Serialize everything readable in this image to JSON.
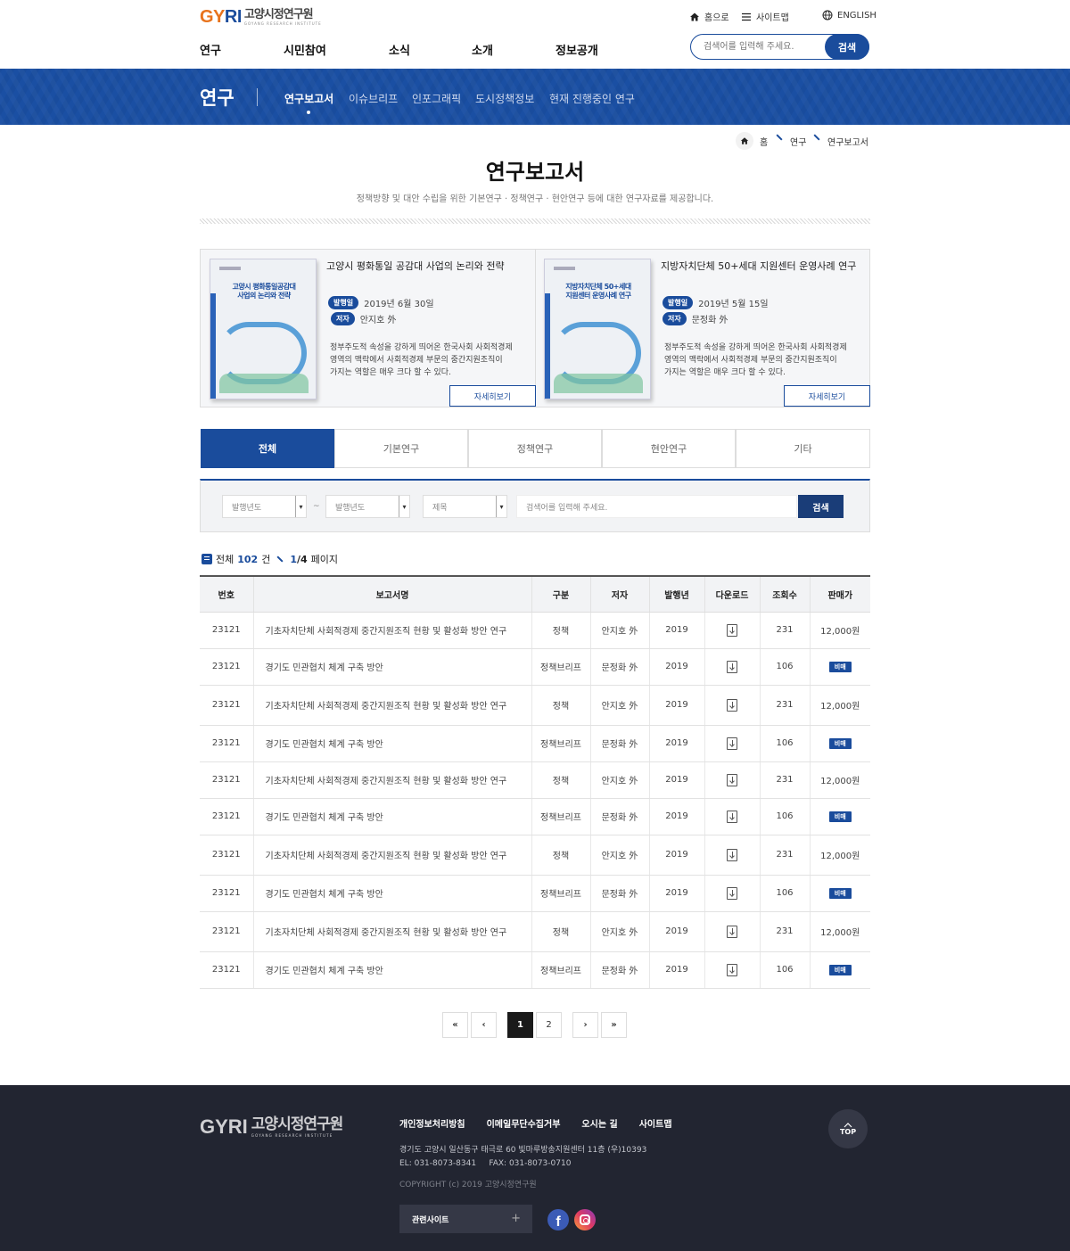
{
  "header": {
    "logo_mark_a": "GY",
    "logo_mark_b": "RI",
    "logo_ko": "고양시정연구원",
    "logo_en": "GOYANG RESEARCH INSTITUTE",
    "util": {
      "home": "홈으로",
      "sitemap": "사이트맵",
      "english": "ENGLISH"
    },
    "gnb": [
      "연구",
      "시민참여",
      "소식",
      "소개",
      "정보공개"
    ],
    "search": {
      "placeholder": "검색어를 입력해 주세요.",
      "button": "검색"
    }
  },
  "section_bar": {
    "title": "연구",
    "subnav": [
      "연구보고서",
      "이슈브리프",
      "인포그래픽",
      "도시정책정보",
      "현재 진행중인 연구"
    ],
    "active_index": 0
  },
  "breadcrumb": [
    "홈",
    "연구",
    "연구보고서"
  ],
  "page": {
    "title": "연구보고서",
    "description": "정책방향 및 대안 수립을 위한 기본연구 · 정책연구 · 현안연구 등에 대한 연구자료를 제공합니다."
  },
  "featured": [
    {
      "cover_title_1": "고양시 평화통일공감대",
      "cover_title_2": "사업의 논리와 전략",
      "title": "고양시 평화통일 공감대 사업의 논리와 전략",
      "date_label": "발행일",
      "date": "2019년 6월 30일",
      "author_label": "저자",
      "author": "안지호 外",
      "desc_1": "정부주도적 속성을 강하게 띄어온 한국사회 사회적경제",
      "desc_2": "영역의 맥락에서 사회적경제 부문의 중간지원조직이",
      "desc_3": "가지는 역할은 매우 크다 할 수 있다.",
      "more": "자세히보기"
    },
    {
      "cover_title_1": "지방자치단체 50+세대",
      "cover_title_2": "지원센터 운영사례 연구",
      "title": "지방자치단체 50+세대 지원센터 운영사례 연구",
      "date_label": "발행일",
      "date": "2019년 5월 15일",
      "author_label": "저자",
      "author": "문정화 外",
      "desc_1": "정부주도적 속성을 강하게 띄어온 한국사회 사회적경제",
      "desc_2": "영역의 맥락에서 사회적경제 부문의 중간지원조직이",
      "desc_3": "가지는 역할은 매우 크다 할 수 있다.",
      "more": "자세히보기"
    }
  ],
  "tabs": [
    "전체",
    "기본연구",
    "정책연구",
    "현안연구",
    "기타"
  ],
  "filter": {
    "year_from": "발행년도",
    "tilde": "~",
    "year_to": "발행년도",
    "field": "제목",
    "placeholder": "검색어를 입력해 주세요.",
    "button": "검색"
  },
  "summary": {
    "total_label": "전체",
    "total": "102",
    "unit": "건",
    "page_current": "1",
    "page_total": "/4",
    "page_label": "페이지"
  },
  "table": {
    "headers": [
      "번호",
      "보고서명",
      "구분",
      "저자",
      "발행년",
      "다운로드",
      "조회수",
      "판매가"
    ],
    "rows": [
      {
        "no": "23121",
        "title": "기초자치단체 사회적경제 중간지원조직 현황 및 활성화 방안 연구",
        "type": "정책",
        "author": "안지호 外",
        "year": "2019",
        "views": "231",
        "price": "12,000원"
      },
      {
        "no": "23121",
        "title": "경기도 민관협치 체계 구축 방안",
        "type": "정책브리프",
        "author": "문정화 外",
        "year": "2019",
        "views": "106",
        "price": "비매"
      },
      {
        "no": "23121",
        "title": "기초자치단체 사회적경제 중간지원조직 현황 및 활성화 방안 연구",
        "type": "정책",
        "author": "안지호 外",
        "year": "2019",
        "views": "231",
        "price": "12,000원"
      },
      {
        "no": "23121",
        "title": "경기도 민관협치 체계 구축 방안",
        "type": "정책브리프",
        "author": "문정화 外",
        "year": "2019",
        "views": "106",
        "price": "비매"
      },
      {
        "no": "23121",
        "title": "기초자치단체 사회적경제 중간지원조직 현황 및 활성화 방안 연구",
        "type": "정책",
        "author": "안지호 外",
        "year": "2019",
        "views": "231",
        "price": "12,000원"
      },
      {
        "no": "23121",
        "title": "경기도 민관협치 체계 구축 방안",
        "type": "정책브리프",
        "author": "문정화 外",
        "year": "2019",
        "views": "106",
        "price": "비매"
      },
      {
        "no": "23121",
        "title": "기초자치단체 사회적경제 중간지원조직 현황 및 활성화 방안 연구",
        "type": "정책",
        "author": "안지호 外",
        "year": "2019",
        "views": "231",
        "price": "12,000원"
      },
      {
        "no": "23121",
        "title": "경기도 민관협치 체계 구축 방안",
        "type": "정책브리프",
        "author": "문정화 外",
        "year": "2019",
        "views": "106",
        "price": "비매"
      },
      {
        "no": "23121",
        "title": "기초자치단체 사회적경제 중간지원조직 현황 및 활성화 방안 연구",
        "type": "정책",
        "author": "안지호 外",
        "year": "2019",
        "views": "231",
        "price": "12,000원"
      },
      {
        "no": "23121",
        "title": "경기도 민관협치 체계 구축 방안",
        "type": "정책브리프",
        "author": "문정화 外",
        "year": "2019",
        "views": "106",
        "price": "비매"
      }
    ]
  },
  "pagination": {
    "first": "«",
    "prev": "‹",
    "pages": [
      "1",
      "2"
    ],
    "current": "1",
    "next": "›",
    "last": "»"
  },
  "footer": {
    "logo_mark": "GYRI",
    "logo_ko": "고양시정연구원",
    "logo_en": "GOYANG RESEARCH INSTITUTE",
    "links": [
      "개인정보처리방침",
      "이메일무단수집거부",
      "오시는 길",
      "사이트맵"
    ],
    "address": "경기도 고양시 일산동구 태극로 60 빛마루방송지원센터 11층 (우)10393",
    "contact": "EL: 031-8073-8341     FAX: 031-8073-0710",
    "copyright": "COPYRIGHT (c) 2019 고양시정연구원",
    "related": "관련사이트",
    "related_plus": "+",
    "top": "TOP",
    "facebook_glyph": "f"
  },
  "colors": {
    "brand_blue": "#1a4c9c",
    "accent_orange": "#e8731c",
    "footer_bg": "#222531"
  }
}
